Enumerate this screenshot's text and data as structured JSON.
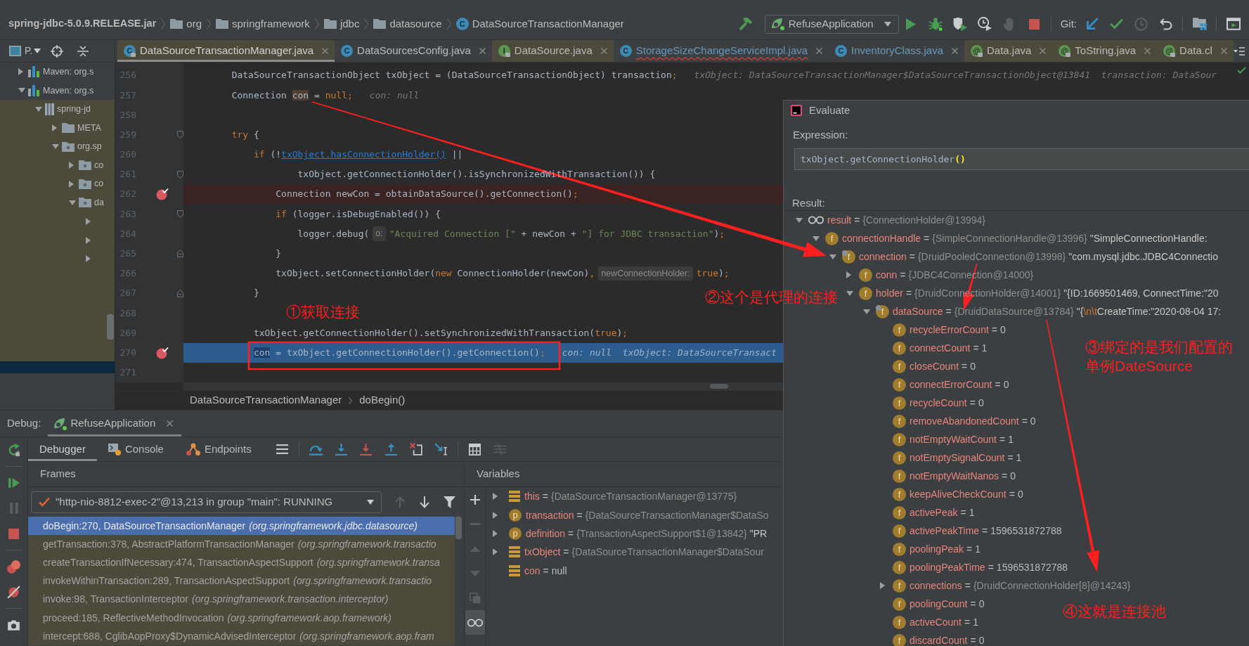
{
  "breadcrumb": [
    {
      "kind": "jar",
      "label": "spring-jdbc-5.0.9.RELEASE.jar"
    },
    {
      "kind": "folder",
      "label": "org"
    },
    {
      "kind": "folder",
      "label": "springframework"
    },
    {
      "kind": "folder",
      "label": "jdbc"
    },
    {
      "kind": "folder",
      "label": "datasource"
    },
    {
      "kind": "class",
      "icon_text": "C",
      "label": "DataSourceTransactionManager"
    }
  ],
  "toolbar": [
    {
      "kind": "build",
      "disabled": false
    },
    {
      "kind": "run_config",
      "label": "RefuseApplication"
    },
    {
      "kind": "run",
      "disabled": false
    },
    {
      "kind": "debug",
      "disabled": false
    },
    {
      "kind": "coverage",
      "disabled": false
    },
    {
      "kind": "profile",
      "disabled": false
    },
    {
      "kind": "attach",
      "disabled": true
    },
    {
      "kind": "stop",
      "disabled": false
    },
    {
      "kind": "separator"
    },
    {
      "kind": "label",
      "label": "Git:"
    },
    {
      "kind": "vcs_update",
      "disabled": false
    },
    {
      "kind": "vcs_commit",
      "disabled": false
    },
    {
      "kind": "history",
      "disabled": true
    },
    {
      "kind": "rollback",
      "disabled": false
    },
    {
      "kind": "separator"
    },
    {
      "kind": "project_structure",
      "disabled": false
    },
    {
      "kind": "separator"
    },
    {
      "kind": "layout",
      "disabled": false
    }
  ],
  "project_panel": {
    "title": "P.",
    "tree": [
      {
        "kind": "library",
        "label": "Maven: org.s",
        "expanded": false,
        "selected": false
      },
      {
        "kind": "library",
        "label": "Maven: org.s",
        "expanded": true,
        "selected": false,
        "children": [
          {
            "kind": "jar",
            "label": "spring-jd",
            "expanded": true,
            "selected": false,
            "children": [
              {
                "kind": "folder",
                "label": "META",
                "expanded": false,
                "selected": false
              },
              {
                "kind": "package",
                "label": "org.sp",
                "expanded": true,
                "selected": false,
                "children": [
                  {
                    "kind": "package",
                    "label": "co",
                    "expanded": false,
                    "selected": false
                  },
                  {
                    "kind": "package",
                    "label": "co",
                    "expanded": false,
                    "selected": false
                  },
                  {
                    "kind": "package",
                    "label": "da",
                    "expanded": true,
                    "selected": false,
                    "children": [
                      {
                        "expanded": false,
                        "selected": false
                      },
                      {
                        "expanded": false,
                        "selected": false
                      },
                      {
                        "expanded": false,
                        "selected": false
                      }
                    ]
                  }
                ]
              }
            ]
          }
        ]
      },
      {
        "selected": true
      }
    ]
  },
  "editor_tabs": [
    {
      "label": "DataSourceTransactionManager.java",
      "kind": "class",
      "icon_text": "C",
      "selected": true,
      "read_only": true,
      "modified": false,
      "error": false
    },
    {
      "label": "DataSourcesConfig.java",
      "kind": "class",
      "icon_text": "C",
      "selected": false,
      "read_only": false,
      "modified": false,
      "error": false
    },
    {
      "label": "DataSource.java",
      "kind": "interface",
      "icon_text": "I",
      "selected": false,
      "read_only": true,
      "modified": false,
      "error": false
    },
    {
      "label": "StorageSizeChangeServiceImpl.java",
      "kind": "class",
      "icon_text": "C",
      "selected": false,
      "read_only": false,
      "modified": true,
      "error": true
    },
    {
      "label": "InventoryClass.java",
      "kind": "class",
      "icon_text": "C",
      "selected": false,
      "read_only": false,
      "modified": true,
      "error": false
    },
    {
      "label": "Data.java",
      "kind": "annotation",
      "icon_text": "@",
      "selected": false,
      "read_only": true,
      "modified": false,
      "error": false
    },
    {
      "label": "ToString.java",
      "kind": "annotation",
      "icon_text": "@",
      "selected": false,
      "read_only": true,
      "modified": false,
      "error": false
    },
    {
      "label": "Data.cl",
      "kind": "annotation",
      "icon_text": "@",
      "selected": false,
      "read_only": true,
      "modified": false,
      "error": false
    }
  ],
  "code": [
    {
      "number": "256",
      "breakpoint": false,
      "current": false,
      "segments": [
        {
          "kind": "plain",
          "text": "        DataSourceTransactionObject txObject = (DataSourceTransactionObject) transaction"
        },
        {
          "kind": "keyword",
          "text": ";"
        },
        {
          "kind": "hint",
          "text": "txObject: DataSourceTransactionManager$DataSourceTransactionObject@13841  transaction: DataSour"
        }
      ]
    },
    {
      "number": "257",
      "breakpoint": false,
      "current": false,
      "segments": [
        {
          "kind": "plain",
          "text": "        Connection "
        },
        {
          "kind": "match",
          "text": "con"
        },
        {
          "kind": "plain",
          "text": " = "
        },
        {
          "kind": "keyword",
          "text": "null;"
        },
        {
          "kind": "hint",
          "text": "con: null"
        }
      ]
    },
    {
      "number": "258",
      "breakpoint": false,
      "current": false
    },
    {
      "number": "259",
      "breakpoint": false,
      "current": false,
      "fold_start": true,
      "segments": [
        {
          "kind": "keyword",
          "text": "        try"
        },
        {
          "kind": "plain",
          "text": " {"
        }
      ]
    },
    {
      "number": "260",
      "breakpoint": false,
      "current": false,
      "segments": [
        {
          "kind": "keyword",
          "text": "            if"
        },
        {
          "kind": "plain",
          "text": " (!"
        },
        {
          "kind": "link",
          "text": "txObject.hasConnectionHolder()"
        },
        {
          "kind": "plain",
          "text": " ||"
        }
      ]
    },
    {
      "number": "261",
      "breakpoint": false,
      "current": false,
      "fold_start": true,
      "segments": [
        {
          "kind": "plain",
          "text": "                    txObject.getConnectionHolder().isSynchronizedWithTransaction()) {"
        }
      ]
    },
    {
      "number": "262",
      "breakpoint": true,
      "current": false,
      "segments": [
        {
          "kind": "plain",
          "text": "                Connection newCon = obtainDataSource().getConnection()"
        },
        {
          "kind": "keyword",
          "text": ";"
        }
      ]
    },
    {
      "number": "263",
      "breakpoint": false,
      "current": false,
      "fold_start": true,
      "segments": [
        {
          "kind": "keyword",
          "text": "                if"
        },
        {
          "kind": "plain",
          "text": " (logger.isDebugEnabled()) {"
        }
      ]
    },
    {
      "number": "264",
      "breakpoint": false,
      "current": false,
      "segments": [
        {
          "kind": "plain",
          "text": "                    logger.debug("
        },
        {
          "kind": "param",
          "text": "o:"
        },
        {
          "kind": "string",
          "text": "\"Acquired Connection [\""
        },
        {
          "kind": "plain",
          "text": " + newCon + "
        },
        {
          "kind": "string",
          "text": "\"] for JDBC transaction\""
        },
        {
          "kind": "plain",
          "text": ")"
        },
        {
          "kind": "keyword",
          "text": ";"
        }
      ]
    },
    {
      "number": "265",
      "breakpoint": false,
      "current": false,
      "fold_end": true,
      "segments": [
        {
          "kind": "plain",
          "text": "                }"
        }
      ]
    },
    {
      "number": "266",
      "breakpoint": false,
      "current": false,
      "segments": [
        {
          "kind": "plain",
          "text": "                txObject.setConnectionHolder("
        },
        {
          "kind": "keyword",
          "text": "new"
        },
        {
          "kind": "plain",
          "text": " ConnectionHolder(newCon)"
        },
        {
          "kind": "keyword",
          "text": ","
        },
        {
          "kind": "param",
          "text": "newConnectionHolder:"
        },
        {
          "kind": "keyword",
          "text": "true"
        },
        {
          "kind": "plain",
          "text": ")"
        },
        {
          "kind": "keyword",
          "text": ";"
        }
      ]
    },
    {
      "number": "267",
      "breakpoint": false,
      "current": false,
      "fold_end": true,
      "segments": [
        {
          "kind": "plain",
          "text": "            }"
        }
      ]
    },
    {
      "number": "268",
      "breakpoint": false,
      "current": false
    },
    {
      "number": "269",
      "breakpoint": false,
      "current": false,
      "segments": [
        {
          "kind": "plain",
          "text": "            txObject.getConnectionHolder().setSynchronizedWithTransaction("
        },
        {
          "kind": "keyword",
          "text": "true"
        },
        {
          "kind": "plain",
          "text": ")"
        },
        {
          "kind": "keyword",
          "text": ";"
        }
      ]
    },
    {
      "number": "270",
      "breakpoint": true,
      "current": true,
      "segments": [
        {
          "kind": "match",
          "text": "            con"
        },
        {
          "kind": "plain",
          "text": " = txObject.getConnectionHolder().getConnection()"
        },
        {
          "kind": "keyword",
          "text": ";"
        },
        {
          "kind": "hint",
          "text": "con: null  txObject: DataSourceTransact"
        }
      ]
    },
    {
      "number": "271",
      "breakpoint": false,
      "current": false
    }
  ],
  "editor_breadcrumb": [
    "DataSourceTransactionManager",
    "doBegin()"
  ],
  "debug": {
    "title": "Debug:",
    "session": {
      "label": "RefuseApplication",
      "selected": true
    },
    "side_buttons": [
      {
        "kind": "rerun",
        "disabled": false
      },
      {
        "kind": "separator"
      },
      {
        "kind": "resume",
        "disabled": false
      },
      {
        "kind": "pause",
        "disabled": true
      },
      {
        "kind": "stop",
        "disabled": false
      },
      {
        "kind": "separator"
      },
      {
        "kind": "breakpoints",
        "disabled": false
      },
      {
        "kind": "mute",
        "disabled": false
      },
      {
        "kind": "separator"
      },
      {
        "kind": "snapshot",
        "disabled": false
      }
    ],
    "tabs": [
      {
        "kind": "plain",
        "label": "Debugger",
        "selected": true
      },
      {
        "kind": "console",
        "label": "Console",
        "selected": false
      },
      {
        "kind": "endpoints",
        "label": "Endpoints",
        "selected": false
      }
    ],
    "actions": [
      {
        "kind": "menu",
        "disabled": false
      },
      {
        "kind": "separator"
      },
      {
        "kind": "step_over",
        "disabled": false
      },
      {
        "kind": "step_into",
        "disabled": false
      },
      {
        "kind": "force_step_into",
        "disabled": false
      },
      {
        "kind": "step_out",
        "disabled": false
      },
      {
        "kind": "drop_frame",
        "disabled": false
      },
      {
        "kind": "run_to_cursor",
        "disabled": false
      },
      {
        "kind": "separator"
      },
      {
        "kind": "evaluate",
        "disabled": false
      },
      {
        "kind": "trace",
        "disabled": true
      }
    ],
    "frames": {
      "title": "Frames",
      "thread": "\"http-nio-8812-exec-2\"@13,213 in group \"main\": RUNNING",
      "nav": [
        {
          "kind": "up",
          "disabled": true
        },
        {
          "kind": "down",
          "disabled": false
        },
        {
          "kind": "filter",
          "disabled": false
        }
      ],
      "rows": [
        {
          "method": "doBegin:270, DataSourceTransactionManager",
          "package": "(org.springframework.jdbc.datasource)",
          "selected": true,
          "library": true
        },
        {
          "method": "getTransaction:378, AbstractPlatformTransactionManager",
          "package": "(org.springframework.transactio",
          "selected": false,
          "library": true
        },
        {
          "method": "createTransactionIfNecessary:474, TransactionAspectSupport",
          "package": "(org.springframework.transa",
          "selected": false,
          "library": true
        },
        {
          "method": "invokeWithinTransaction:289, TransactionAspectSupport",
          "package": "(org.springframework.transactio",
          "selected": false,
          "library": true
        },
        {
          "method": "invoke:98, TransactionInterceptor",
          "package": "(org.springframework.transaction.interceptor)",
          "selected": false,
          "library": true
        },
        {
          "method": "proceed:185, ReflectiveMethodInvocation",
          "package": "(org.springframework.aop.framework)",
          "selected": false,
          "library": true
        },
        {
          "method": "intercept:688, CglibAopProxy$DynamicAdvisedInterceptor",
          "package": "(org.springframework.aop.fram",
          "selected": false,
          "library": true
        }
      ]
    },
    "variables": {
      "title": "Variables",
      "tools": [
        {
          "kind": "add",
          "disabled": false,
          "on": false
        },
        {
          "kind": "remove",
          "disabled": true,
          "on": false
        },
        {
          "kind": "up",
          "disabled": true,
          "on": false
        },
        {
          "kind": "down",
          "disabled": true,
          "on": false
        },
        {
          "kind": "copy",
          "disabled": true,
          "on": false
        },
        {
          "kind": "watches",
          "disabled": false,
          "on": true
        }
      ],
      "rows": [
        {
          "kind": "local",
          "name": "this",
          "operator": "=",
          "ref": "{DataSourceTransactionManager@13775}",
          "expanded": false
        },
        {
          "kind": "param",
          "icon_text": "p",
          "name": "transaction",
          "operator": "=",
          "ref": "{DataSourceTransactionManager$DataSo",
          "expanded": false
        },
        {
          "kind": "param",
          "icon_text": "p",
          "name": "definition",
          "operator": "=",
          "ref": "{TransactionAspectSupport$1@13842}",
          "detail": [
            {
              "kind": "plain",
              "text": "\"PR"
            }
          ],
          "expanded": false
        },
        {
          "kind": "local",
          "name": "txObject",
          "operator": "=",
          "ref": "{DataSourceTransactionManager$DataSour",
          "expanded": false
        },
        {
          "kind": "local",
          "name": "con",
          "operator": "=",
          "value": "null"
        }
      ]
    }
  },
  "evaluate": {
    "title": "Evaluate",
    "expression_label": "Expression:",
    "expression": [
      {
        "kind": "plain",
        "text": "txObject.getConnectionHolder"
      },
      {
        "kind": "brace_match",
        "text": "()"
      }
    ],
    "result_label": "Result:",
    "tree": [
      {
        "kind": "watch",
        "name": "result",
        "operator": "=",
        "ref": "{ConnectionHolder@13994}",
        "expanded": true,
        "children": [
          {
            "kind": "field",
            "icon_text": "f",
            "overlay": false,
            "name": "connectionHandle",
            "operator": "=",
            "ref": "{SimpleConnectionHandle@13996}",
            "detail": [
              {
                "kind": "plain",
                "text": "\"SimpleConnectionHandle:"
              }
            ],
            "expanded": true,
            "children": [
              {
                "kind": "field",
                "icon_text": "f",
                "overlay": true,
                "name": "connection",
                "operator": "=",
                "ref": "{DruidPooledConnection@13998}",
                "detail": [
                  {
                    "kind": "plain",
                    "text": "\"com.mysql.jdbc.JDBC4Connectio"
                  }
                ],
                "expanded": true,
                "children": [
                  {
                    "kind": "field",
                    "icon_text": "f",
                    "overlay": false,
                    "name": "conn",
                    "operator": "=",
                    "ref": "{JDBC4Connection@14000}",
                    "expanded": false
                  },
                  {
                    "kind": "field",
                    "icon_text": "f",
                    "overlay": false,
                    "name": "holder",
                    "operator": "=",
                    "ref": "{DruidConnectionHolder@14001}",
                    "detail": [
                      {
                        "kind": "plain",
                        "text": "\"{ID:1669501469, ConnectTime:\"20"
                      }
                    ],
                    "expanded": true,
                    "children": [
                      {
                        "kind": "field",
                        "icon_text": "f",
                        "overlay": true,
                        "name": "dataSource",
                        "operator": "=",
                        "ref": "{DruidDataSource@13784}",
                        "detail": [
                          {
                            "kind": "plain",
                            "text": "\"{"
                          },
                          {
                            "kind": "escape",
                            "text": "\\n\\t"
                          },
                          {
                            "kind": "plain",
                            "text": "CreateTime:\"2020-08-04 17:"
                          }
                        ],
                        "expanded": true,
                        "children": [
                          {
                            "kind": "field",
                            "icon_text": "f",
                            "overlay": false,
                            "name": "recycleErrorCount",
                            "operator": "=",
                            "value": "0"
                          },
                          {
                            "kind": "field",
                            "icon_text": "f",
                            "overlay": false,
                            "name": "connectCount",
                            "operator": "=",
                            "value": "1"
                          },
                          {
                            "kind": "field",
                            "icon_text": "f",
                            "overlay": false,
                            "name": "closeCount",
                            "operator": "=",
                            "value": "0"
                          },
                          {
                            "kind": "field",
                            "icon_text": "f",
                            "overlay": false,
                            "name": "connectErrorCount",
                            "operator": "=",
                            "value": "0"
                          },
                          {
                            "kind": "field",
                            "icon_text": "f",
                            "overlay": false,
                            "name": "recycleCount",
                            "operator": "=",
                            "value": "0"
                          },
                          {
                            "kind": "field",
                            "icon_text": "f",
                            "overlay": false,
                            "name": "removeAbandonedCount",
                            "operator": "=",
                            "value": "0"
                          },
                          {
                            "kind": "field",
                            "icon_text": "f",
                            "overlay": false,
                            "name": "notEmptyWaitCount",
                            "operator": "=",
                            "value": "1"
                          },
                          {
                            "kind": "field",
                            "icon_text": "f",
                            "overlay": false,
                            "name": "notEmptySignalCount",
                            "operator": "=",
                            "value": "1"
                          },
                          {
                            "kind": "field",
                            "icon_text": "f",
                            "overlay": false,
                            "name": "notEmptyWaitNanos",
                            "operator": "=",
                            "value": "0"
                          },
                          {
                            "kind": "field",
                            "icon_text": "f",
                            "overlay": false,
                            "name": "keepAliveCheckCount",
                            "operator": "=",
                            "value": "0"
                          },
                          {
                            "kind": "field",
                            "icon_text": "f",
                            "overlay": false,
                            "name": "activePeak",
                            "operator": "=",
                            "value": "1"
                          },
                          {
                            "kind": "field",
                            "icon_text": "f",
                            "overlay": false,
                            "name": "activePeakTime",
                            "operator": "=",
                            "value": "1596531872788"
                          },
                          {
                            "kind": "field",
                            "icon_text": "f",
                            "overlay": false,
                            "name": "poolingPeak",
                            "operator": "=",
                            "value": "1"
                          },
                          {
                            "kind": "field",
                            "icon_text": "f",
                            "overlay": false,
                            "name": "poolingPeakTime",
                            "operator": "=",
                            "value": "1596531872788"
                          },
                          {
                            "kind": "field",
                            "icon_text": "f",
                            "overlay": false,
                            "name": "connections",
                            "operator": "=",
                            "ref": "{DruidConnectionHolder[8]@14243}",
                            "expanded": false
                          },
                          {
                            "kind": "field",
                            "icon_text": "f",
                            "overlay": false,
                            "name": "poolingCount",
                            "operator": "=",
                            "value": "0"
                          },
                          {
                            "kind": "field",
                            "icon_text": "f",
                            "overlay": false,
                            "name": "activeCount",
                            "operator": "=",
                            "value": "1"
                          },
                          {
                            "kind": "field",
                            "icon_text": "f",
                            "overlay": false,
                            "name": "discardCount",
                            "operator": "=",
                            "value": "0"
                          }
                        ]
                      }
                    ]
                  }
                ]
              }
            ]
          }
        ]
      }
    ]
  },
  "annotations": [
    {
      "lines": [
        "①获取连接"
      ]
    },
    {
      "lines": [
        "②这个是代理的连接"
      ]
    },
    {
      "lines": [
        "③绑定的是我们配置的",
        "单例DateSource"
      ]
    },
    {
      "lines": [
        "④这就是连接池"
      ]
    }
  ]
}
